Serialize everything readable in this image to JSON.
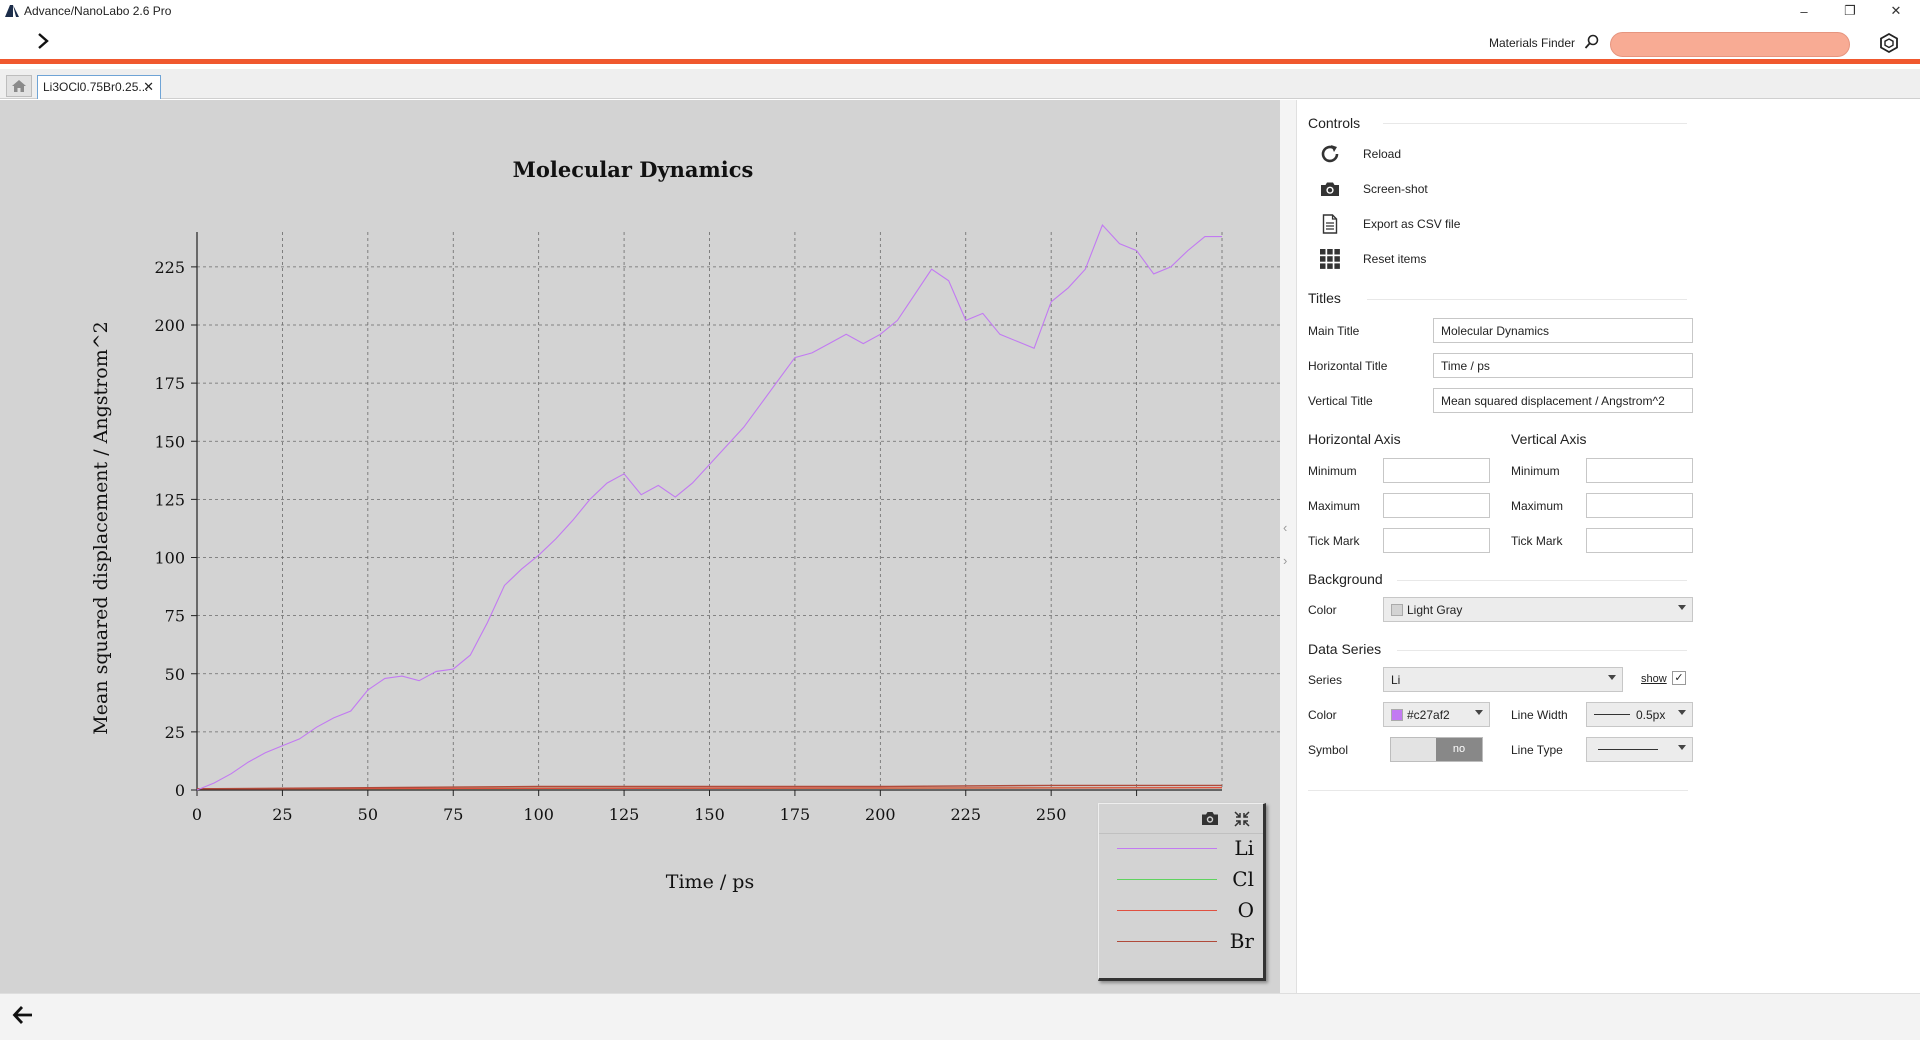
{
  "window": {
    "title": "Advance/NanoLabo 2.6 Pro",
    "controls": [
      "–",
      "❐",
      "✕"
    ]
  },
  "toolbar": {
    "finder_label": "Materials Finder",
    "finder_value": ""
  },
  "tabs": {
    "file_tab": "Li3OCl0.75Br0.25...",
    "close": "✕"
  },
  "chart_data": {
    "type": "line",
    "title": "Molecular Dynamics",
    "xlabel": "Time / ps",
    "ylabel": "Mean squared displacement / Angstrom^2",
    "xlim": [
      0,
      300
    ],
    "ylim": [
      0,
      240
    ],
    "xticks": [
      0,
      25,
      50,
      75,
      100,
      125,
      150,
      175,
      200,
      225,
      250,
      275
    ],
    "yticks": [
      0,
      25,
      50,
      75,
      100,
      125,
      150,
      175,
      200,
      225
    ],
    "grid": true,
    "background": "#d3d3d3",
    "legend_position": "bottom-right",
    "series": [
      {
        "name": "Li",
        "color": "#c27af2",
        "x": [
          0,
          5,
          10,
          15,
          20,
          25,
          30,
          35,
          40,
          45,
          50,
          55,
          60,
          65,
          70,
          75,
          80,
          85,
          90,
          95,
          100,
          105,
          110,
          115,
          120,
          125,
          130,
          135,
          140,
          145,
          150,
          155,
          160,
          165,
          170,
          175,
          180,
          185,
          190,
          195,
          200,
          205,
          210,
          215,
          220,
          225,
          230,
          235,
          240,
          245,
          250,
          255,
          260,
          265,
          270,
          275,
          280,
          285,
          290,
          295,
          300
        ],
        "values": [
          0,
          3,
          7,
          12,
          16,
          19,
          22,
          27,
          31,
          34,
          43,
          48,
          49,
          47,
          51,
          52,
          58,
          72,
          88,
          95,
          101,
          108,
          116,
          125,
          132,
          136,
          127,
          131,
          126,
          132,
          140,
          148,
          156,
          166,
          176,
          186,
          188,
          192,
          196,
          192,
          196,
          202,
          213,
          224,
          219,
          202,
          205,
          196,
          193,
          190,
          210,
          216,
          224,
          243,
          235,
          232,
          222,
          225,
          232,
          238,
          238
        ]
      },
      {
        "name": "Cl",
        "color": "#5fd35f",
        "x": [
          0,
          300
        ],
        "values": [
          0.5,
          1
        ]
      },
      {
        "name": "O",
        "color": "#e05040",
        "x": [
          0,
          300
        ],
        "values": [
          0.5,
          1
        ]
      },
      {
        "name": "Br",
        "color": "#b04a3a",
        "x": [
          0,
          50,
          100,
          150,
          200,
          250,
          300
        ],
        "values": [
          0.5,
          1,
          1.5,
          1.5,
          1.5,
          2,
          2
        ]
      }
    ]
  },
  "controls": {
    "heading": "Controls",
    "reload": "Reload",
    "screenshot": "Screen-shot",
    "export": "Export as CSV file",
    "reset": "Reset items"
  },
  "titles": {
    "heading": "Titles",
    "main_label": "Main Title",
    "main_value": "Molecular Dynamics",
    "horizontal_label": "Horizontal Title",
    "horizontal_value": "Time / ps",
    "vertical_label": "Vertical Title",
    "vertical_value": "Mean squared displacement / Angstrom^2"
  },
  "axes": {
    "horizontal_heading": "Horizontal Axis",
    "vertical_heading": "Vertical Axis",
    "minimum": "Minimum",
    "maximum": "Maximum",
    "tick_mark": "Tick Mark"
  },
  "background": {
    "heading": "Background",
    "color_label": "Color",
    "color_value": "Light Gray",
    "swatch": "#d3d3d3"
  },
  "data_series": {
    "heading": "Data Series",
    "series_label": "Series",
    "series_value": "Li",
    "show_label": "show",
    "show_checked": true,
    "color_label": "Color",
    "color_value": "#c27af2",
    "line_width_label": "Line Width",
    "line_width_value": "0.5px",
    "symbol_label": "Symbol",
    "symbol_value": "no",
    "line_type_label": "Line Type"
  }
}
